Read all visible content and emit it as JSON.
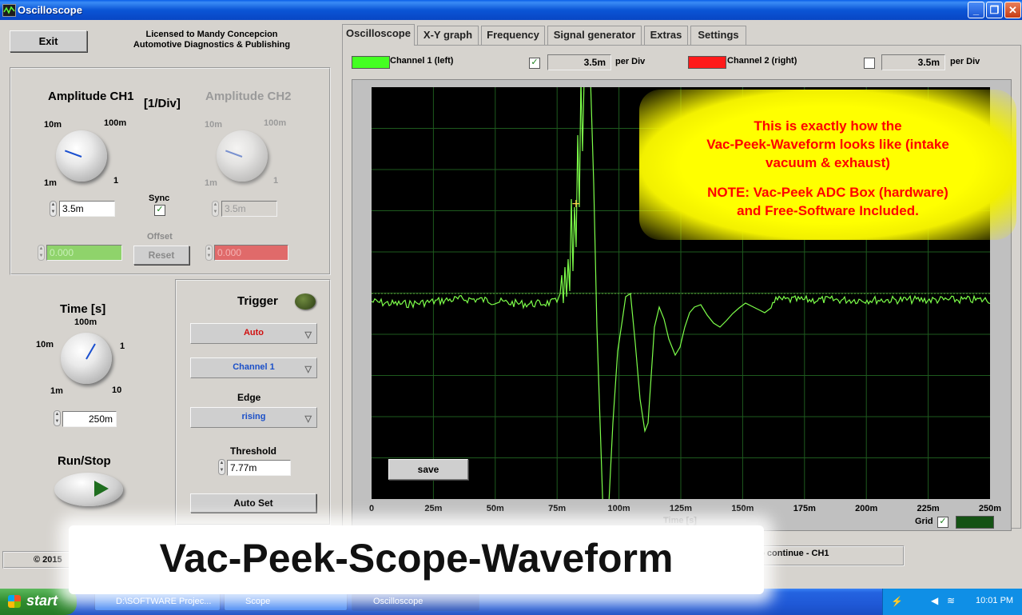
{
  "window": {
    "title": "Oscilloscope"
  },
  "header": {
    "exit_label": "Exit",
    "license_line1": "Licensed to Mandy Concepcion",
    "license_line2": "Automotive Diagnostics & Publishing"
  },
  "amplitude": {
    "ch1_title": "Amplitude CH1",
    "unit": "[1/Div]",
    "ch2_title": "Amplitude CH2",
    "scale_10m": "10m",
    "scale_100m": "100m",
    "scale_1m": "1m",
    "scale_1": "1",
    "ch1_value": "3.5m",
    "ch2_value": "3.5m",
    "sync_label": "Sync",
    "sync_checked": true,
    "offset_label": "Offset",
    "ch1_offset": "0.000",
    "ch2_offset": "0.000",
    "reset_label": "Reset"
  },
  "time": {
    "title": "Time [s]",
    "scale_100m": "100m",
    "scale_10m": "10m",
    "scale_1": "1",
    "scale_1m": "1m",
    "scale_10": "10",
    "value": "250m"
  },
  "runstop": {
    "label": "Run/Stop"
  },
  "trigger": {
    "title": "Trigger",
    "mode": "Auto",
    "source": "Channel 1",
    "edge_label": "Edge",
    "edge": "rising",
    "threshold_label": "Threshold",
    "threshold": "7.77m",
    "autoset_label": "Auto Set"
  },
  "footer": {
    "copyright": "© 2015",
    "status": "op to continue - CH1"
  },
  "tabs": [
    "Oscilloscope",
    "X-Y graph",
    "Frequency",
    "Signal generator",
    "Extras",
    "Settings"
  ],
  "channels": {
    "ch1_label": "Channel 1 (left)",
    "ch1_value": "3.5m",
    "ch1_checked": true,
    "ch2_label": "Channel 2 (right)",
    "ch2_value": "3.5m",
    "ch2_checked": false,
    "per_div": "per Div",
    "ch1_color": "#44ff22",
    "ch2_color": "#ff1a1a"
  },
  "plot": {
    "save_label": "save",
    "xlabel": "Time [s]",
    "grid_label": "Grid",
    "grid_checked": true,
    "x_ticks": [
      "0",
      "25m",
      "50m",
      "75m",
      "100m",
      "125m",
      "150m",
      "175m",
      "200m",
      "225m",
      "250m"
    ],
    "trace_color": "#7dff4a"
  },
  "callout": {
    "line1": "This is exactly how the",
    "line2": "Vac-Peek-Waveform looks like (intake",
    "line3": "vacuum & exhaust)",
    "line4": "NOTE: Vac-Peek ADC Box (hardware)",
    "line5": "and Free-Software Included."
  },
  "banner": {
    "text": "Vac-Peek-Scope-Waveform"
  },
  "taskbar": {
    "start_label": "start",
    "items": [
      "D:\\SOFTWARE Projec...",
      "Scope",
      "Oscilloscope"
    ],
    "clock": "10:01 PM"
  }
}
